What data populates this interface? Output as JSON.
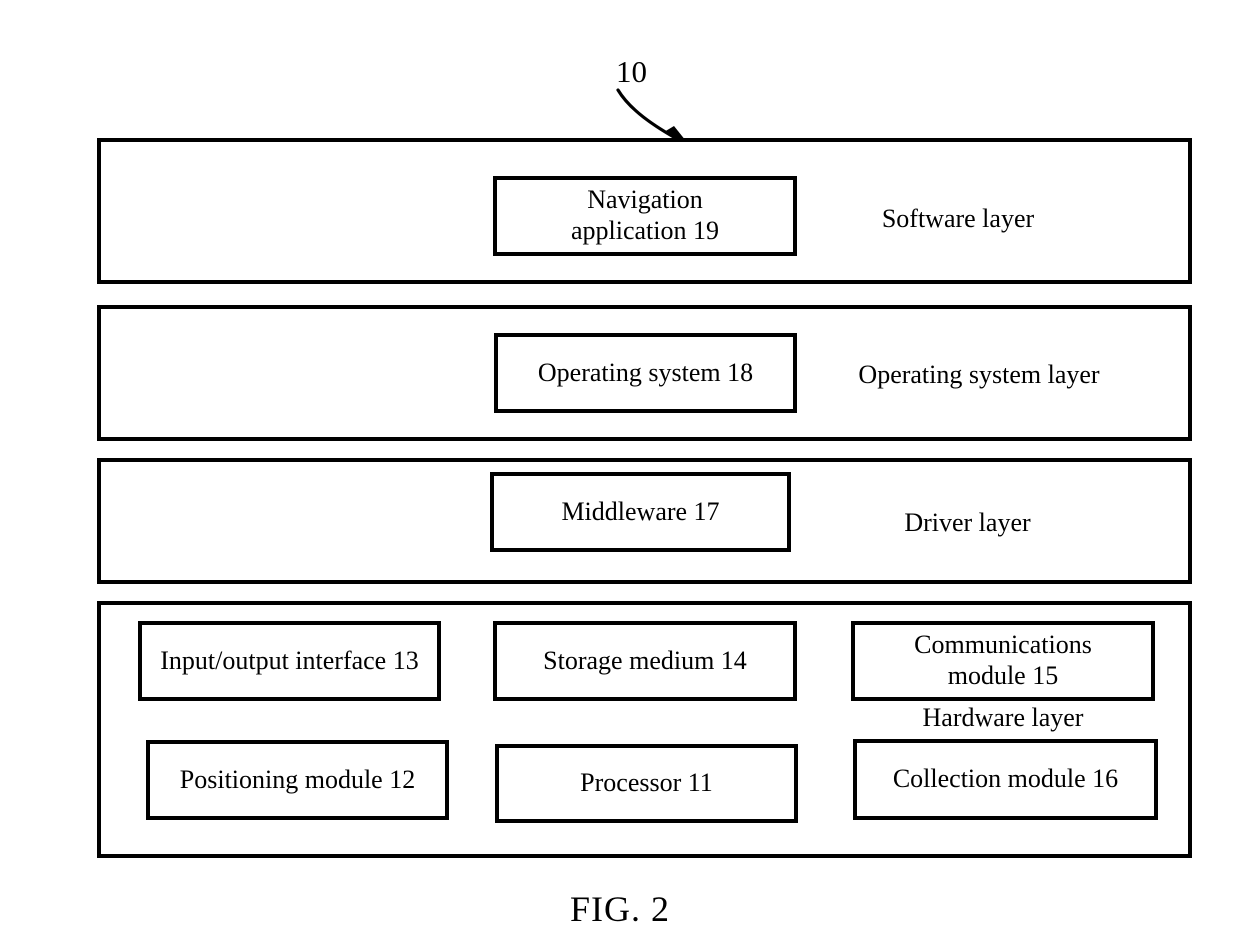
{
  "figure": {
    "caption": "FIG. 2",
    "reference_numeral": "10"
  },
  "layers": [
    {
      "id": "software-layer",
      "caption": "Software layer",
      "components": [
        {
          "id": "navigation-application",
          "label": "Navigation\napplication 19"
        }
      ]
    },
    {
      "id": "operating-system-layer",
      "caption": "Operating system layer",
      "components": [
        {
          "id": "operating-system",
          "label": "Operating system 18"
        }
      ]
    },
    {
      "id": "driver-layer",
      "caption": "Driver layer",
      "components": [
        {
          "id": "middleware",
          "label": "Middleware 17"
        }
      ]
    },
    {
      "id": "hardware-layer",
      "caption": "Hardware layer",
      "components": [
        {
          "id": "input-output-interface",
          "label": "Input/output interface 13"
        },
        {
          "id": "storage-medium",
          "label": "Storage medium 14"
        },
        {
          "id": "communications-module",
          "label": "Communications\nmodule 15"
        },
        {
          "id": "positioning-module",
          "label": "Positioning module 12"
        },
        {
          "id": "processor",
          "label": "Processor 11"
        },
        {
          "id": "collection-module",
          "label": "Collection module 16"
        }
      ]
    }
  ],
  "colors": {
    "stroke": "#000000",
    "background": "#ffffff"
  }
}
